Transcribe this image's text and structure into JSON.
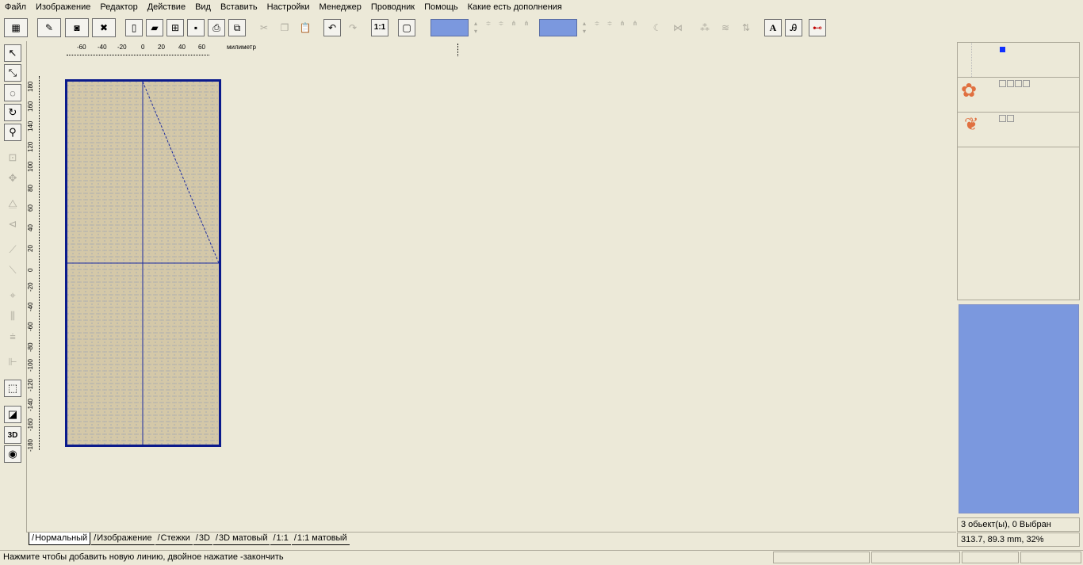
{
  "menu": [
    "Файл",
    "Изображение",
    "Редактор",
    "Действие",
    "Вид",
    "Вставить",
    "Настройки",
    "Менеджер",
    "Проводник",
    "Помощь",
    "Какие есть дополнения"
  ],
  "toolbar": {
    "zoom_label": "1:1",
    "text_tool_label": "A"
  },
  "left_toolbar": {
    "threed_label": "3D"
  },
  "ruler": {
    "unit": "милиметр",
    "h_labels": [
      "-60",
      "-40",
      "-20",
      "0",
      "20",
      "40",
      "60"
    ],
    "v_labels": [
      "180",
      "160",
      "140",
      "120",
      "100",
      "80",
      "60",
      "40",
      "20",
      "0",
      "-20",
      "-40",
      "-60",
      "-80",
      "-100",
      "-120",
      "-140",
      "-160",
      "-180"
    ]
  },
  "colors": {
    "swatch": "#7b98de",
    "canvas_bg": "#d4c8a8",
    "canvas_border": "#0a1a8c",
    "preview_bg": "#7b98de"
  },
  "status": {
    "objects": "3 обьект(ы), 0 Выбран",
    "coords": "313.7, 89.3 mm, 32%",
    "hint": "Нажмите чтобы добавить новую линию, двойное нажатие -закончить"
  },
  "tabs": [
    "Нормальный",
    "Изображение",
    "Стежки",
    "3D",
    "3D матовый",
    "1:1",
    "1:1 матовый"
  ]
}
